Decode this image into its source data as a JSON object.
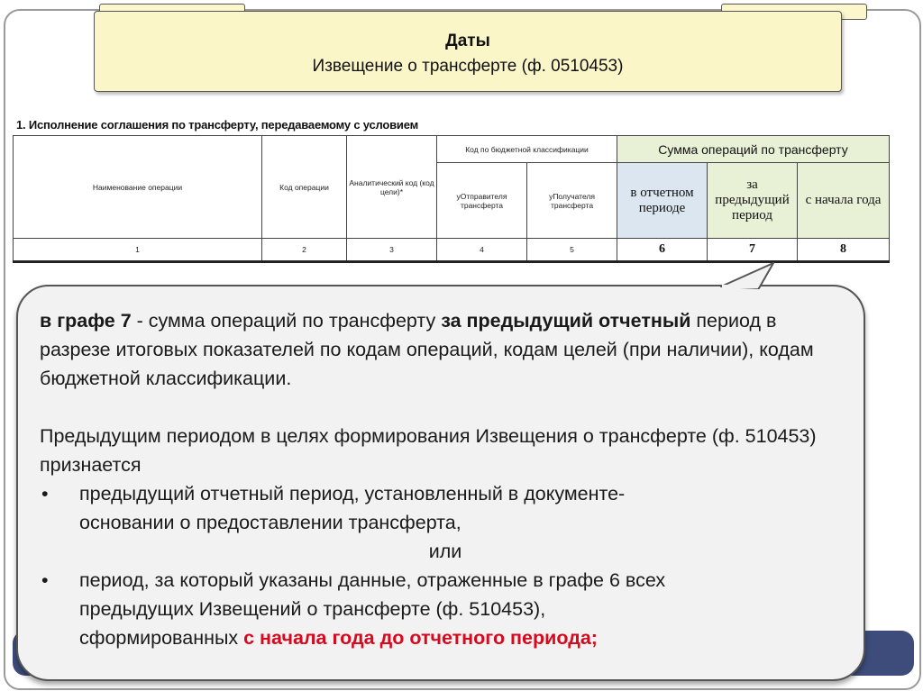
{
  "header": {
    "title": "Даты",
    "subtitle": "Извещение о трансферте (ф. 0510453)"
  },
  "section_title": "1. Исполнение соглашения по трансферту, передаваемому с условием",
  "table": {
    "col_op_name": "Наименование операции",
    "col_op_code": "Код операции",
    "col_analytic": "Аналитический код (код цели)*",
    "col_budget_group": "Код по бюджетной классификации",
    "col_sender": "уОтправителя трансферта",
    "col_receiver": "уПолучателя трансферта",
    "col_sum_group": "Сумма операций по трансферту",
    "col_current": "в отчетном периоде",
    "col_previous": "за предыдущий период",
    "col_ytd": "с начала года",
    "numbers": [
      "1",
      "2",
      "3",
      "4",
      "5",
      "6",
      "7",
      "8"
    ]
  },
  "callout": {
    "p1_label": "в графе 7",
    "p1_dash": " - сумма операций по трансферту ",
    "p1_bold": "за предыдущий отчетный",
    "p1_rest": "период в разрезе итоговых показателей по кодам операций, кодам целей (при наличии), кодам бюджетной классификации.",
    "p2": "Предыдущим периодом в целях формирования Извещения о трансферте (ф. 510453) признается",
    "bullet_char": "•",
    "b1_line1": "предыдущий отчетный период, установленный в документе-",
    "b1_line2": "основании о предоставлении трансферта,",
    "or": "или",
    "b2_line1": "период, за который указаны данные, отраженные в графе 6 всех",
    "b2_line2": "предыдущих Извещений о трансферте (ф. 510453),",
    "b2_line3_plain": "сформированных ",
    "b2_line3_red": "с начала года до отчетного периода;"
  },
  "colors": {
    "banner_bg": "#fbf6c8",
    "sum_header_bg": "#e8f0d6",
    "sum_sub_bg": "#dce6f1",
    "callout_bg": "#f2f2f2",
    "accent_red": "#d6091e"
  }
}
